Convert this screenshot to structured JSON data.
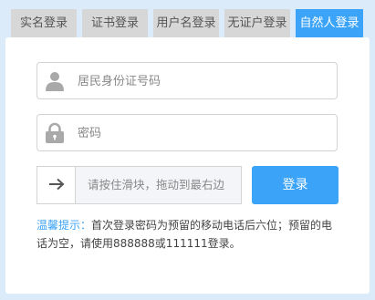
{
  "tabs": [
    {
      "label": "实名登录",
      "active": false
    },
    {
      "label": "证书登录",
      "active": false
    },
    {
      "label": "用户名登录",
      "active": false
    },
    {
      "label": "无证户登录",
      "active": false
    },
    {
      "label": "自然人登录",
      "active": true
    }
  ],
  "form": {
    "id_placeholder": "居民身份证号码",
    "id_value": "",
    "password_placeholder": "密码",
    "password_value": "",
    "slider_text": "请按住滑块，拖动到最右边",
    "login_label": "登录"
  },
  "tip": {
    "label": "温馨提示：",
    "text": "首次登录密码为预留的移动电话后六位；预留的电话为空，请使用888888或111111登录。"
  },
  "icons": {
    "id_field": "user-icon",
    "password_field": "lock-icon",
    "slider_handle": "arrow-right-icon"
  },
  "colors": {
    "accent": "#3ba3f8",
    "background": "#dcebfa",
    "tab_inactive": "#d7d7d7"
  }
}
